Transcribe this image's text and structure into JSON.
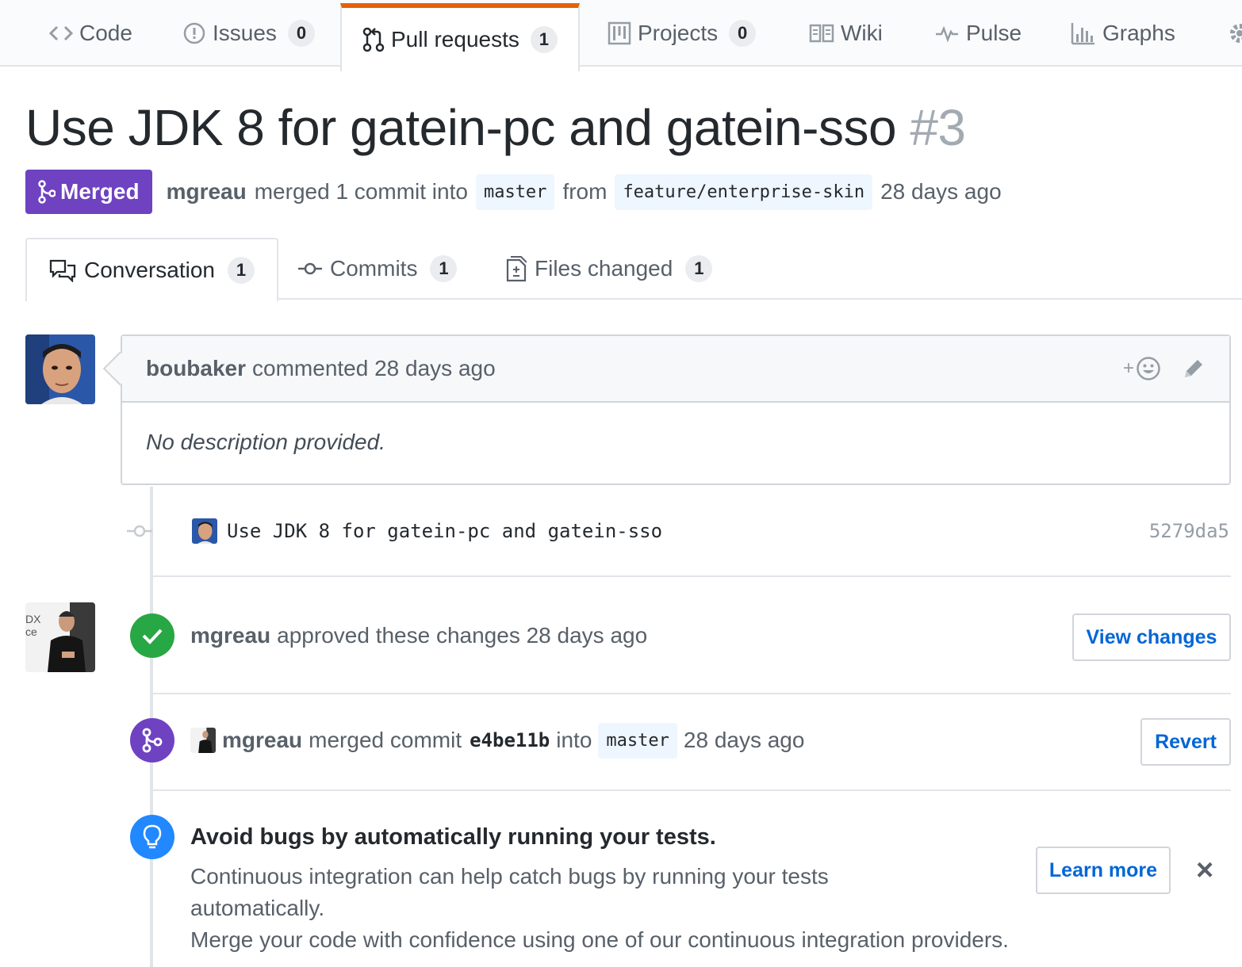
{
  "repo_nav": {
    "tabs": [
      {
        "label": "Code",
        "icon": "code-icon"
      },
      {
        "label": "Issues",
        "count": "0",
        "icon": "issue-icon"
      },
      {
        "label": "Pull requests",
        "count": "1",
        "icon": "git-pull-request-icon",
        "selected": true
      },
      {
        "label": "Projects",
        "count": "0",
        "icon": "project-icon"
      },
      {
        "label": "Wiki",
        "icon": "book-icon"
      },
      {
        "label": "Pulse",
        "icon": "pulse-icon"
      },
      {
        "label": "Graphs",
        "icon": "graph-icon"
      }
    ]
  },
  "pr": {
    "title": "Use JDK 8 for gatein-pc and gatein-sso",
    "number": "#3",
    "state": "Merged",
    "author": "mgreau",
    "merge_text": "merged 1 commit into",
    "base_branch": "master",
    "from_text": "from",
    "head_branch": "feature/enterprise-skin",
    "time": "28 days ago"
  },
  "pr_tabs": [
    {
      "label": "Conversation",
      "count": "1",
      "icon": "comment-discussion-icon"
    },
    {
      "label": "Commits",
      "count": "1",
      "icon": "git-commit-icon"
    },
    {
      "label": "Files changed",
      "count": "1",
      "icon": "diff-icon"
    }
  ],
  "comment": {
    "author": "boubaker",
    "action": "commented 28 days ago",
    "reaction_label": "+",
    "body": "No description provided."
  },
  "commit": {
    "message": "Use JDK 8 for gatein-pc and gatein-sso",
    "sha": "5279da5"
  },
  "review": {
    "author": "mgreau",
    "text": "approved these changes 28 days ago",
    "button": "View changes"
  },
  "merge_event": {
    "author": "mgreau",
    "text_before": "merged commit",
    "sha": "e4be11b",
    "text_into": "into",
    "branch": "master",
    "time": "28 days ago",
    "button": "Revert"
  },
  "ci_tip": {
    "title": "Avoid bugs by automatically running your tests.",
    "line1": "Continuous integration can help catch bugs by running your tests",
    "line2": "automatically.",
    "line3": "Merge your code with confidence using one of our continuous integration providers.",
    "button": "Learn more",
    "close_label": "×"
  },
  "colors": {
    "merged_purple": "#6f42c1",
    "approved_green": "#28a745",
    "tip_blue": "#2188ff",
    "link_blue": "#0366d6",
    "nav_selected_orange": "#e36209"
  }
}
